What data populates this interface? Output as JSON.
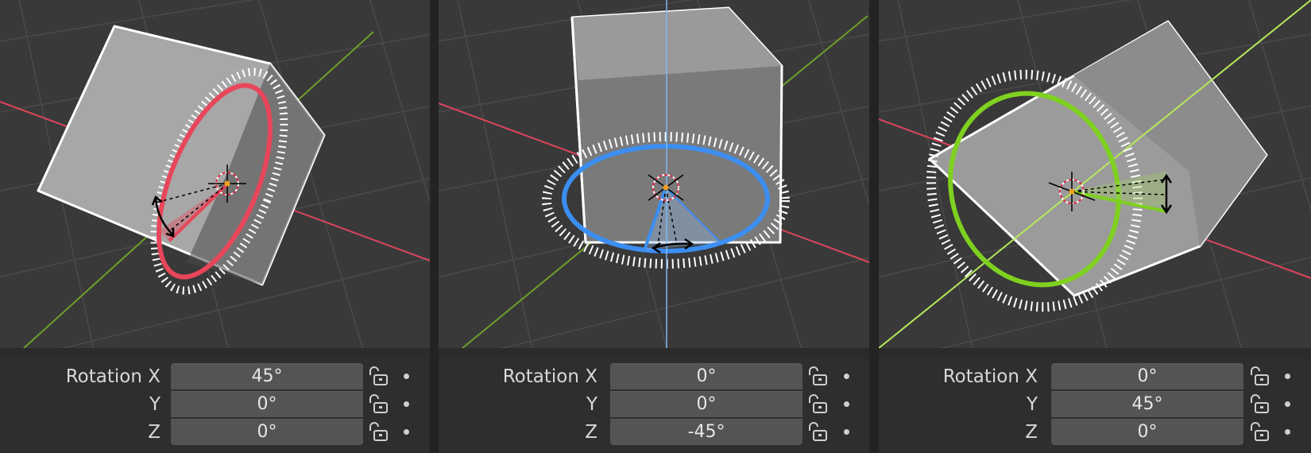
{
  "colors": {
    "x_axis": "#e8465a",
    "y_axis": "#7fc41f",
    "z_axis": "#3c8ef0",
    "viewport_bg": "#393939",
    "grid": "#4a4a4a",
    "field_bg": "#545454"
  },
  "panels": [
    {
      "id": "x",
      "gizmo_axis": "x",
      "rotation_label": "Rotation X",
      "fields": [
        {
          "axis": "X",
          "value": "45°"
        },
        {
          "axis": "Y",
          "value": "0°"
        },
        {
          "axis": "Z",
          "value": "0°"
        }
      ],
      "icons": [
        "lock-open-icon",
        "keyframe-dot-icon"
      ]
    },
    {
      "id": "z",
      "gizmo_axis": "z",
      "rotation_label": "Rotation X",
      "fields": [
        {
          "axis": "X",
          "value": "0°"
        },
        {
          "axis": "Y",
          "value": "0°"
        },
        {
          "axis": "Z",
          "value": "-45°"
        }
      ],
      "icons": [
        "lock-open-icon",
        "keyframe-dot-icon"
      ]
    },
    {
      "id": "y",
      "gizmo_axis": "y",
      "rotation_label": "Rotation X",
      "fields": [
        {
          "axis": "X",
          "value": "0°"
        },
        {
          "axis": "Y",
          "value": "45°"
        },
        {
          "axis": "Z",
          "value": "0°"
        }
      ],
      "icons": [
        "lock-open-icon",
        "keyframe-dot-icon"
      ]
    }
  ],
  "labels": {
    "y": "Y",
    "z": "Z"
  }
}
